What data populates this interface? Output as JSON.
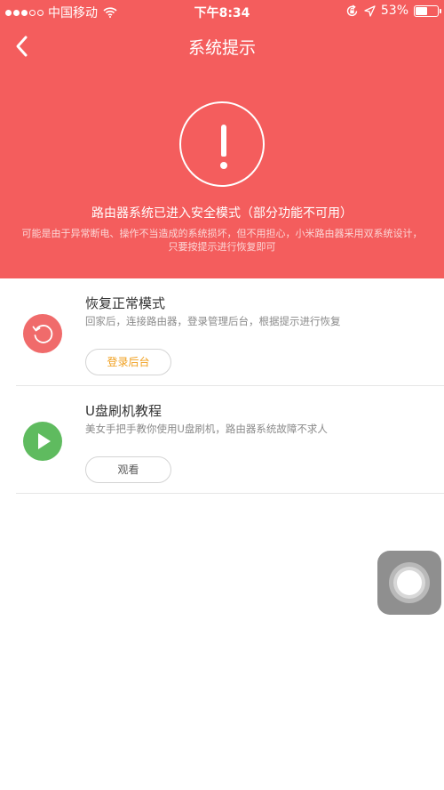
{
  "status_bar": {
    "carrier": "中国移动",
    "time": "下午8:34",
    "battery": "53%",
    "battery_level": 0.53,
    "signal_full_dots": 3,
    "signal_total_dots": 5,
    "icons": [
      "signal-icon",
      "wifi-icon",
      "orientation-lock-icon",
      "location-icon",
      "battery-icon"
    ]
  },
  "nav": {
    "title": "系统提示",
    "back_icon": "chevron-left-icon"
  },
  "warning": {
    "icon": "exclamation-icon",
    "title": "路由器系统已进入安全模式（部分功能不可用）",
    "description": "可能是由于异常断电、操作不当造成的系统损坏，但不用担心，小米路由器采用双系统设计，只要按提示进行恢复即可"
  },
  "actions": [
    {
      "title": "恢复正常模式",
      "description": "回家后，连接路由器，登录管理后台，根据提示进行恢复",
      "button_label": "登录后台",
      "icon": "restore-icon",
      "icon_color": "#f06b6b",
      "button_color": "#f0a020"
    },
    {
      "title": "U盘刷机教程",
      "description": "美女手把手教你使用U盘刷机，路由器系统故障不求人",
      "button_label": "观看",
      "icon": "play-icon",
      "icon_color": "#5fbb5f",
      "button_color": "#555555"
    }
  ],
  "colors": {
    "accent": "#f45d5d"
  }
}
